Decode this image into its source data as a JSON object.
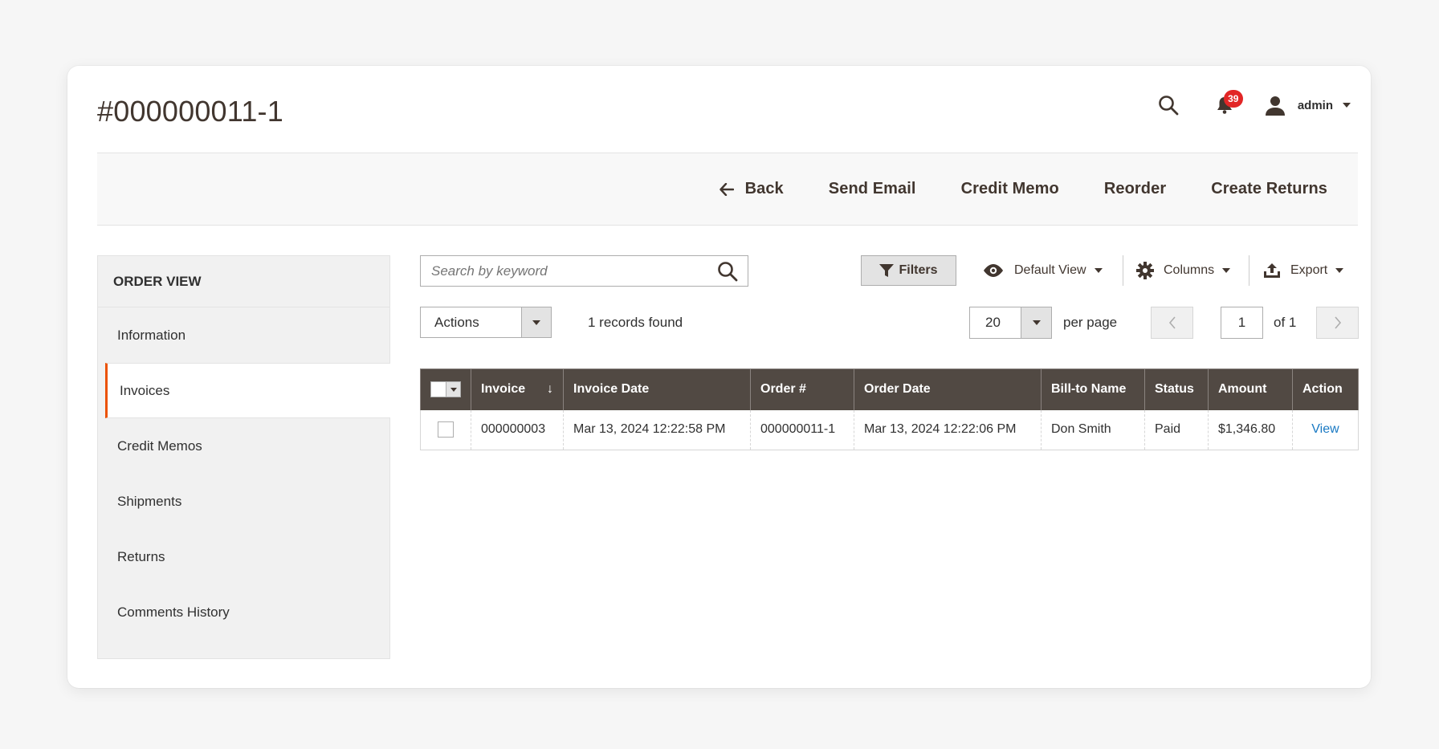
{
  "page": {
    "title": "#000000011-1"
  },
  "header": {
    "notifications_count": "39",
    "user_name": "admin",
    "icons": {
      "search": "search-icon",
      "notifications": "bell-icon",
      "user": "user-icon",
      "menu_caret": "caret-down-icon"
    }
  },
  "toolbar": {
    "back_label": "Back",
    "buttons": [
      "Send Email",
      "Credit Memo",
      "Reorder",
      "Create Returns"
    ]
  },
  "sidebar": {
    "heading": "ORDER VIEW",
    "items": [
      {
        "label": "Information",
        "active": false
      },
      {
        "label": "Invoices",
        "active": true
      },
      {
        "label": "Credit Memos",
        "active": false
      },
      {
        "label": "Shipments",
        "active": false
      },
      {
        "label": "Returns",
        "active": false
      },
      {
        "label": "Comments History",
        "active": false
      }
    ]
  },
  "grid": {
    "search_placeholder": "Search by keyword",
    "search_value": "",
    "filters_label": "Filters",
    "view_label": "Default View",
    "columns_label": "Columns",
    "export_label": "Export",
    "actions_label": "Actions",
    "records_found": "1 records found",
    "per_page_value": "20",
    "per_page_label": "per page",
    "current_page": "1",
    "page_total_label": "of 1",
    "columns": [
      "Invoice",
      "Invoice Date",
      "Order #",
      "Order Date",
      "Bill-to Name",
      "Status",
      "Amount",
      "Action"
    ],
    "sorted_column": "Invoice",
    "sort_direction": "descending",
    "rows": [
      {
        "invoice": "000000003",
        "invoice_date": "Mar 13, 2024 12:22:58 PM",
        "order_number": "000000011-1",
        "order_date": "Mar 13, 2024 12:22:06 PM",
        "bill_to_name": "Don Smith",
        "status": "Paid",
        "amount": "$1,346.80",
        "action": "View",
        "selected": false
      }
    ]
  },
  "colors": {
    "accent": "#eb5202",
    "header_dark": "#514943",
    "badge": "#e22626",
    "link": "#1979c3",
    "text_dark": "#41362f"
  }
}
